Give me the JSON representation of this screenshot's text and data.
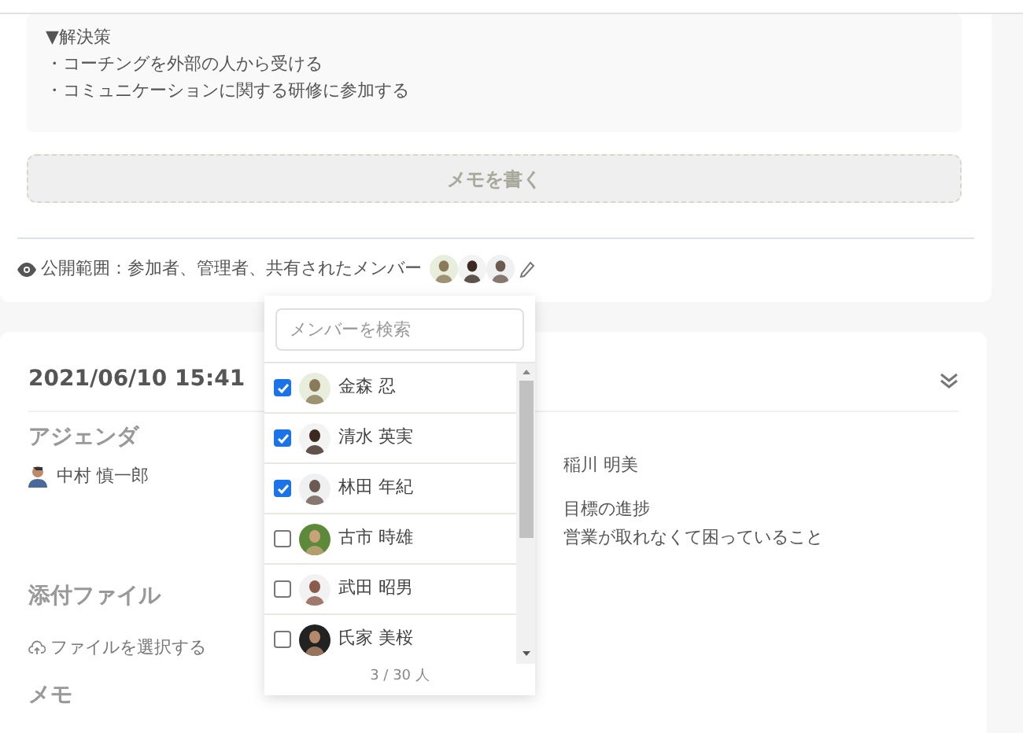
{
  "memo_card": {
    "content_lines": [
      "▼解決策",
      "・コーチングを外部の人から受ける",
      "・コミュニケーションに関する研修に参加する"
    ],
    "write_memo_button": {
      "label": "メモを書く",
      "disabled": true
    },
    "visibility": "公開範囲：参加者、管理者、共有されたメンバー"
  },
  "member_picker": {
    "search": {
      "placeholder": "メンバーを検索"
    },
    "members": [
      {
        "name": "金森 忍",
        "checked": true
      },
      {
        "name": "清水 英実",
        "checked": true
      },
      {
        "name": "林田 年紀",
        "checked": true
      },
      {
        "name": "古市 時雄",
        "checked": false
      },
      {
        "name": "武田 昭男",
        "checked": false
      },
      {
        "name": "氏家 美桜",
        "checked": false
      }
    ],
    "count": "3 / 30 人"
  },
  "meeting_card": {
    "date": "2021/06/10 15:41",
    "agenda_heading": "アジェンダ",
    "person": "中村 慎一郎",
    "other_person": "稲川 明美",
    "agenda_items": [
      "目標の進捗",
      "営業が取れなくて困っていること"
    ],
    "attachments_heading": "添付ファイル",
    "file_button": "ファイルを選択する",
    "memo_heading": "メモ"
  }
}
